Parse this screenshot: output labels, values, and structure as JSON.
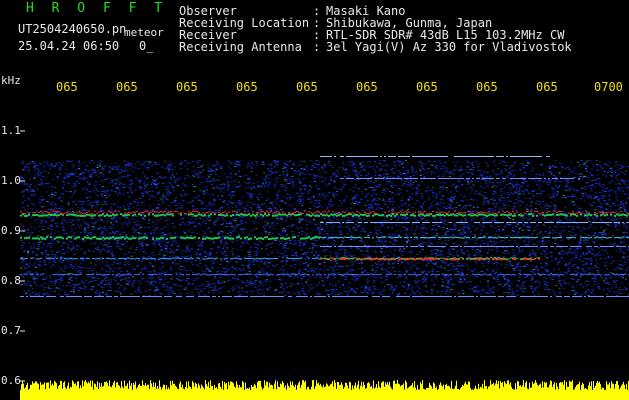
{
  "header": {
    "title": "H R O F F T",
    "filename": "UT2504240650.pn",
    "tag": "meteor",
    "datetime": "25.04.24 06:50",
    "dots": "0_"
  },
  "meta": [
    {
      "key": "Observer",
      "sep": ":",
      "value": "Masaki Kano"
    },
    {
      "key": "Receiving Location",
      "sep": ":",
      "value": "Shibukawa, Gunma, Japan"
    },
    {
      "key": "Receiver",
      "sep": ":",
      "value": "RTL-SDR SDR# 43dB L15 103.2MHz CW"
    },
    {
      "key": "Receiving Antenna",
      "sep": ":",
      "value": "3el Yagi(V) Az 330 for Vladivostok"
    }
  ],
  "x_ticks": [
    "065",
    "065",
    "065",
    "065",
    "065",
    "065",
    "065",
    "065",
    "065",
    "0700"
  ],
  "y_axis": {
    "unit": "kHz",
    "labels": [
      "1.1",
      "1.0",
      "0.9",
      "0.8",
      "0.7",
      "0.6"
    ]
  },
  "colors": {
    "background": "#000000",
    "title": "#1ee01e",
    "ticks": "#f0e000",
    "signal_strong": "#ff2a2a",
    "signal_medium": "#18c850",
    "noise": "#1a3cff",
    "level_meter": "#ffff00"
  }
}
